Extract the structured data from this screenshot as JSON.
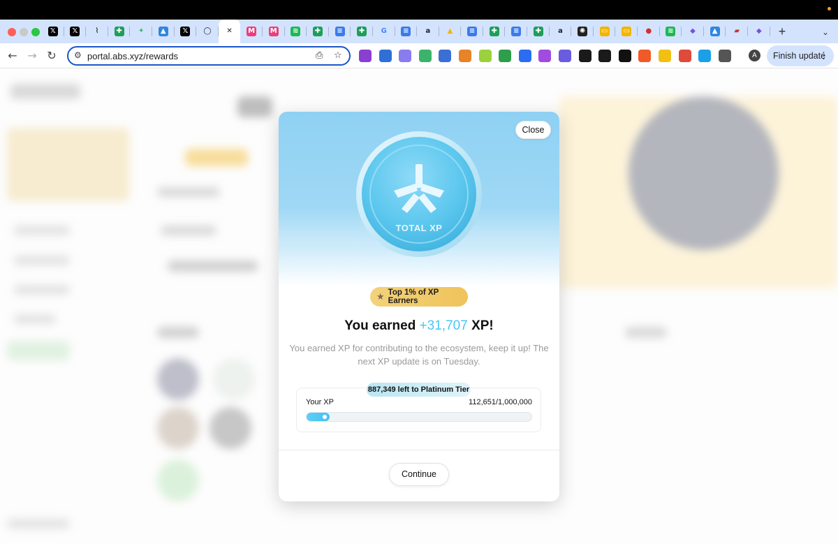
{
  "browser": {
    "url": "portal.abs.xyz/rewards",
    "finish_update_label": "Finish update",
    "profile_initial": "A",
    "new_tab_glyph": "+",
    "tabs": [
      {
        "icon": "x-icon",
        "glyph": "𝕏",
        "bg": "#000000",
        "fg": "#ffffff"
      },
      {
        "icon": "x-icon",
        "glyph": "𝕏",
        "bg": "#000000",
        "fg": "#ffffff"
      },
      {
        "icon": "broom-icon",
        "glyph": "⌇",
        "bg": "transparent",
        "fg": "#333333"
      },
      {
        "icon": "sheets-icon",
        "glyph": "✚",
        "bg": "#1e9e5a",
        "fg": "#ffffff"
      },
      {
        "icon": "green-leaf-icon",
        "glyph": "✦",
        "bg": "transparent",
        "fg": "#3bb36a"
      },
      {
        "icon": "blue-drop-icon",
        "glyph": "▲",
        "bg": "#2f86e0",
        "fg": "#ffffff"
      },
      {
        "icon": "x-icon",
        "glyph": "𝕏",
        "bg": "#000000",
        "fg": "#ffffff"
      },
      {
        "icon": "ring-icon",
        "glyph": "◯",
        "bg": "transparent",
        "fg": "#222222"
      },
      {
        "icon": "close-tab-icon",
        "glyph": "✕",
        "bg": "transparent",
        "fg": "#222222",
        "active": true
      },
      {
        "icon": "magic-eden-icon",
        "glyph": "M",
        "bg": "#e8407a",
        "fg": "#ffffff"
      },
      {
        "icon": "magic-eden-icon",
        "glyph": "M",
        "bg": "#e8407a",
        "fg": "#ffffff"
      },
      {
        "icon": "spotify-icon",
        "glyph": "≋",
        "bg": "#1db954",
        "fg": "#ffffff"
      },
      {
        "icon": "sheets-icon",
        "glyph": "✚",
        "bg": "#1e9e5a",
        "fg": "#ffffff"
      },
      {
        "icon": "docs-icon",
        "glyph": "≡",
        "bg": "#3b7bea",
        "fg": "#ffffff"
      },
      {
        "icon": "sheets-icon",
        "glyph": "✚",
        "bg": "#1e9e5a",
        "fg": "#ffffff"
      },
      {
        "icon": "google-icon",
        "glyph": "G",
        "bg": "transparent",
        "fg": "#4285f4"
      },
      {
        "icon": "docs-icon",
        "glyph": "≡",
        "bg": "#3b7bea",
        "fg": "#ffffff"
      },
      {
        "icon": "alx-icon",
        "glyph": "a",
        "bg": "transparent",
        "fg": "#222222"
      },
      {
        "icon": "drive-icon",
        "glyph": "▲",
        "bg": "transparent",
        "fg": "#f4b400"
      },
      {
        "icon": "docs-icon",
        "glyph": "≡",
        "bg": "#3b7bea",
        "fg": "#ffffff"
      },
      {
        "icon": "sheets-icon",
        "glyph": "✚",
        "bg": "#1e9e5a",
        "fg": "#ffffff"
      },
      {
        "icon": "docs-icon",
        "glyph": "≡",
        "bg": "#3b7bea",
        "fg": "#ffffff"
      },
      {
        "icon": "sheets-icon",
        "glyph": "✚",
        "bg": "#1e9e5a",
        "fg": "#ffffff"
      },
      {
        "icon": "alx-icon",
        "glyph": "a",
        "bg": "transparent",
        "fg": "#222222"
      },
      {
        "icon": "openai-icon",
        "glyph": "✺",
        "bg": "#222222",
        "fg": "#ffffff"
      },
      {
        "icon": "slides-icon",
        "glyph": "▭",
        "bg": "#f4b400",
        "fg": "#ffffff"
      },
      {
        "icon": "slides-icon",
        "glyph": "▭",
        "bg": "#f4b400",
        "fg": "#ffffff"
      },
      {
        "icon": "record-icon",
        "glyph": "●",
        "bg": "transparent",
        "fg": "#d23030"
      },
      {
        "icon": "spotify-icon",
        "glyph": "≋",
        "bg": "#1db954",
        "fg": "#ffffff"
      },
      {
        "icon": "cube-icon",
        "glyph": "◆",
        "bg": "transparent",
        "fg": "#7a4fe0"
      },
      {
        "icon": "blue-drop-icon",
        "glyph": "▲",
        "bg": "#2f86e0",
        "fg": "#ffffff"
      },
      {
        "icon": "red-hat-icon",
        "glyph": "▰",
        "bg": "transparent",
        "fg": "#c0392b"
      },
      {
        "icon": "cube-icon",
        "glyph": "◆",
        "bg": "transparent",
        "fg": "#7a4fe0"
      }
    ],
    "extensions": [
      {
        "icon": "headphones-ext-icon",
        "color": "#8a3fd1"
      },
      {
        "icon": "blue-square-ext-icon",
        "color": "#2f6fd6"
      },
      {
        "icon": "purple-bird-ext-icon",
        "color": "#8a7cf0"
      },
      {
        "icon": "frog-ext-icon",
        "color": "#3bb36a"
      },
      {
        "icon": "shield-ext-icon",
        "color": "#3b6fd6"
      },
      {
        "icon": "metamask-ext-icon",
        "color": "#e8832a"
      },
      {
        "icon": "green-leaf-ext-icon",
        "color": "#9bd13c"
      },
      {
        "icon": "green-circle-ext-icon",
        "color": "#2e9e4a"
      },
      {
        "icon": "k-ext-icon",
        "color": "#2a6df0"
      },
      {
        "icon": "purple-gear-ext-icon",
        "color": "#a14be0"
      },
      {
        "icon": "phantom-ext-icon",
        "color": "#6a5ce0"
      },
      {
        "icon": "black-shield-ext-icon",
        "color": "#1a1a1a"
      },
      {
        "icon": "game-ext-icon",
        "color": "#1a1a1a"
      },
      {
        "icon": "p-ext-icon",
        "color": "#111111"
      },
      {
        "icon": "orange-ext-icon",
        "color": "#f05a28"
      },
      {
        "icon": "yellow-s-ext-icon",
        "color": "#f2c012"
      },
      {
        "icon": "lock-ext-icon",
        "color": "#e04a3a"
      },
      {
        "icon": "blue-v-ext-icon",
        "color": "#1aa0e8"
      },
      {
        "icon": "puzzle-ext-icon",
        "color": "#555555"
      }
    ]
  },
  "modal": {
    "close_label": "Close",
    "coin_label": "TOTAL XP",
    "badge_label": "Top 1% of XP Earners",
    "earned_prefix": "You earned ",
    "earned_amount": "+31,707",
    "earned_suffix": " XP!",
    "description": "You earned XP for contributing to the ecosystem, keep it up! The next XP update is on Tuesday.",
    "tier_pill": "887,349 left to Platinum Tier",
    "xp_label": "Your XP",
    "xp_value": "112,651/1,000,000",
    "xp_progress_fraction": 0.112651,
    "continue_label": "Continue",
    "accent_color": "#48c6f4"
  }
}
